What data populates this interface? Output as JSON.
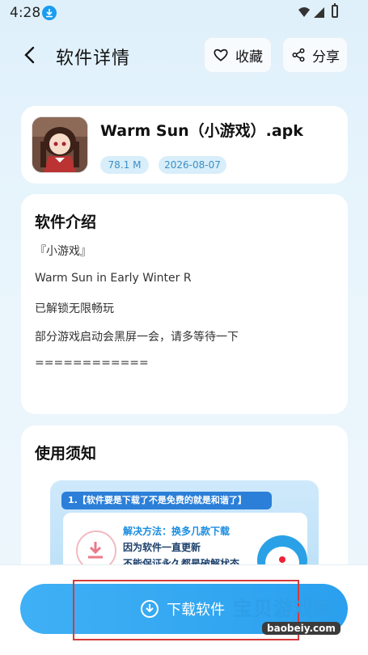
{
  "status": {
    "time": "4:28",
    "download_icon": "download-icon"
  },
  "nav": {
    "title": "软件详情",
    "favorite_label": "收藏",
    "share_label": "分享"
  },
  "app": {
    "name": "Warm Sun（小游戏）.apk",
    "size": "78.1 M",
    "date": "2026-08-07"
  },
  "intro": {
    "title": "软件介绍",
    "lines": [
      "『小游戏』",
      "Warm Sun in Early Winter R",
      "已解锁无限畅玩",
      "部分游戏启动会黑屏一会，请多等待一下",
      "============"
    ]
  },
  "notice": {
    "title": "使用须知",
    "banner": "1.【软件要是下载了不是免费的就是和谐了】",
    "lines": [
      "解决方法：换多几款下载",
      "因为软件一直更新",
      "不能保证永久都是破解状态"
    ]
  },
  "download": {
    "label": "下载软件"
  },
  "watermark": {
    "text": "宝贝游戏网",
    "url": "baobeiy.com"
  },
  "colors": {
    "accent": "#2aa0ee",
    "tag_bg": "#d8eefa",
    "tag_text": "#3d8fc4"
  }
}
